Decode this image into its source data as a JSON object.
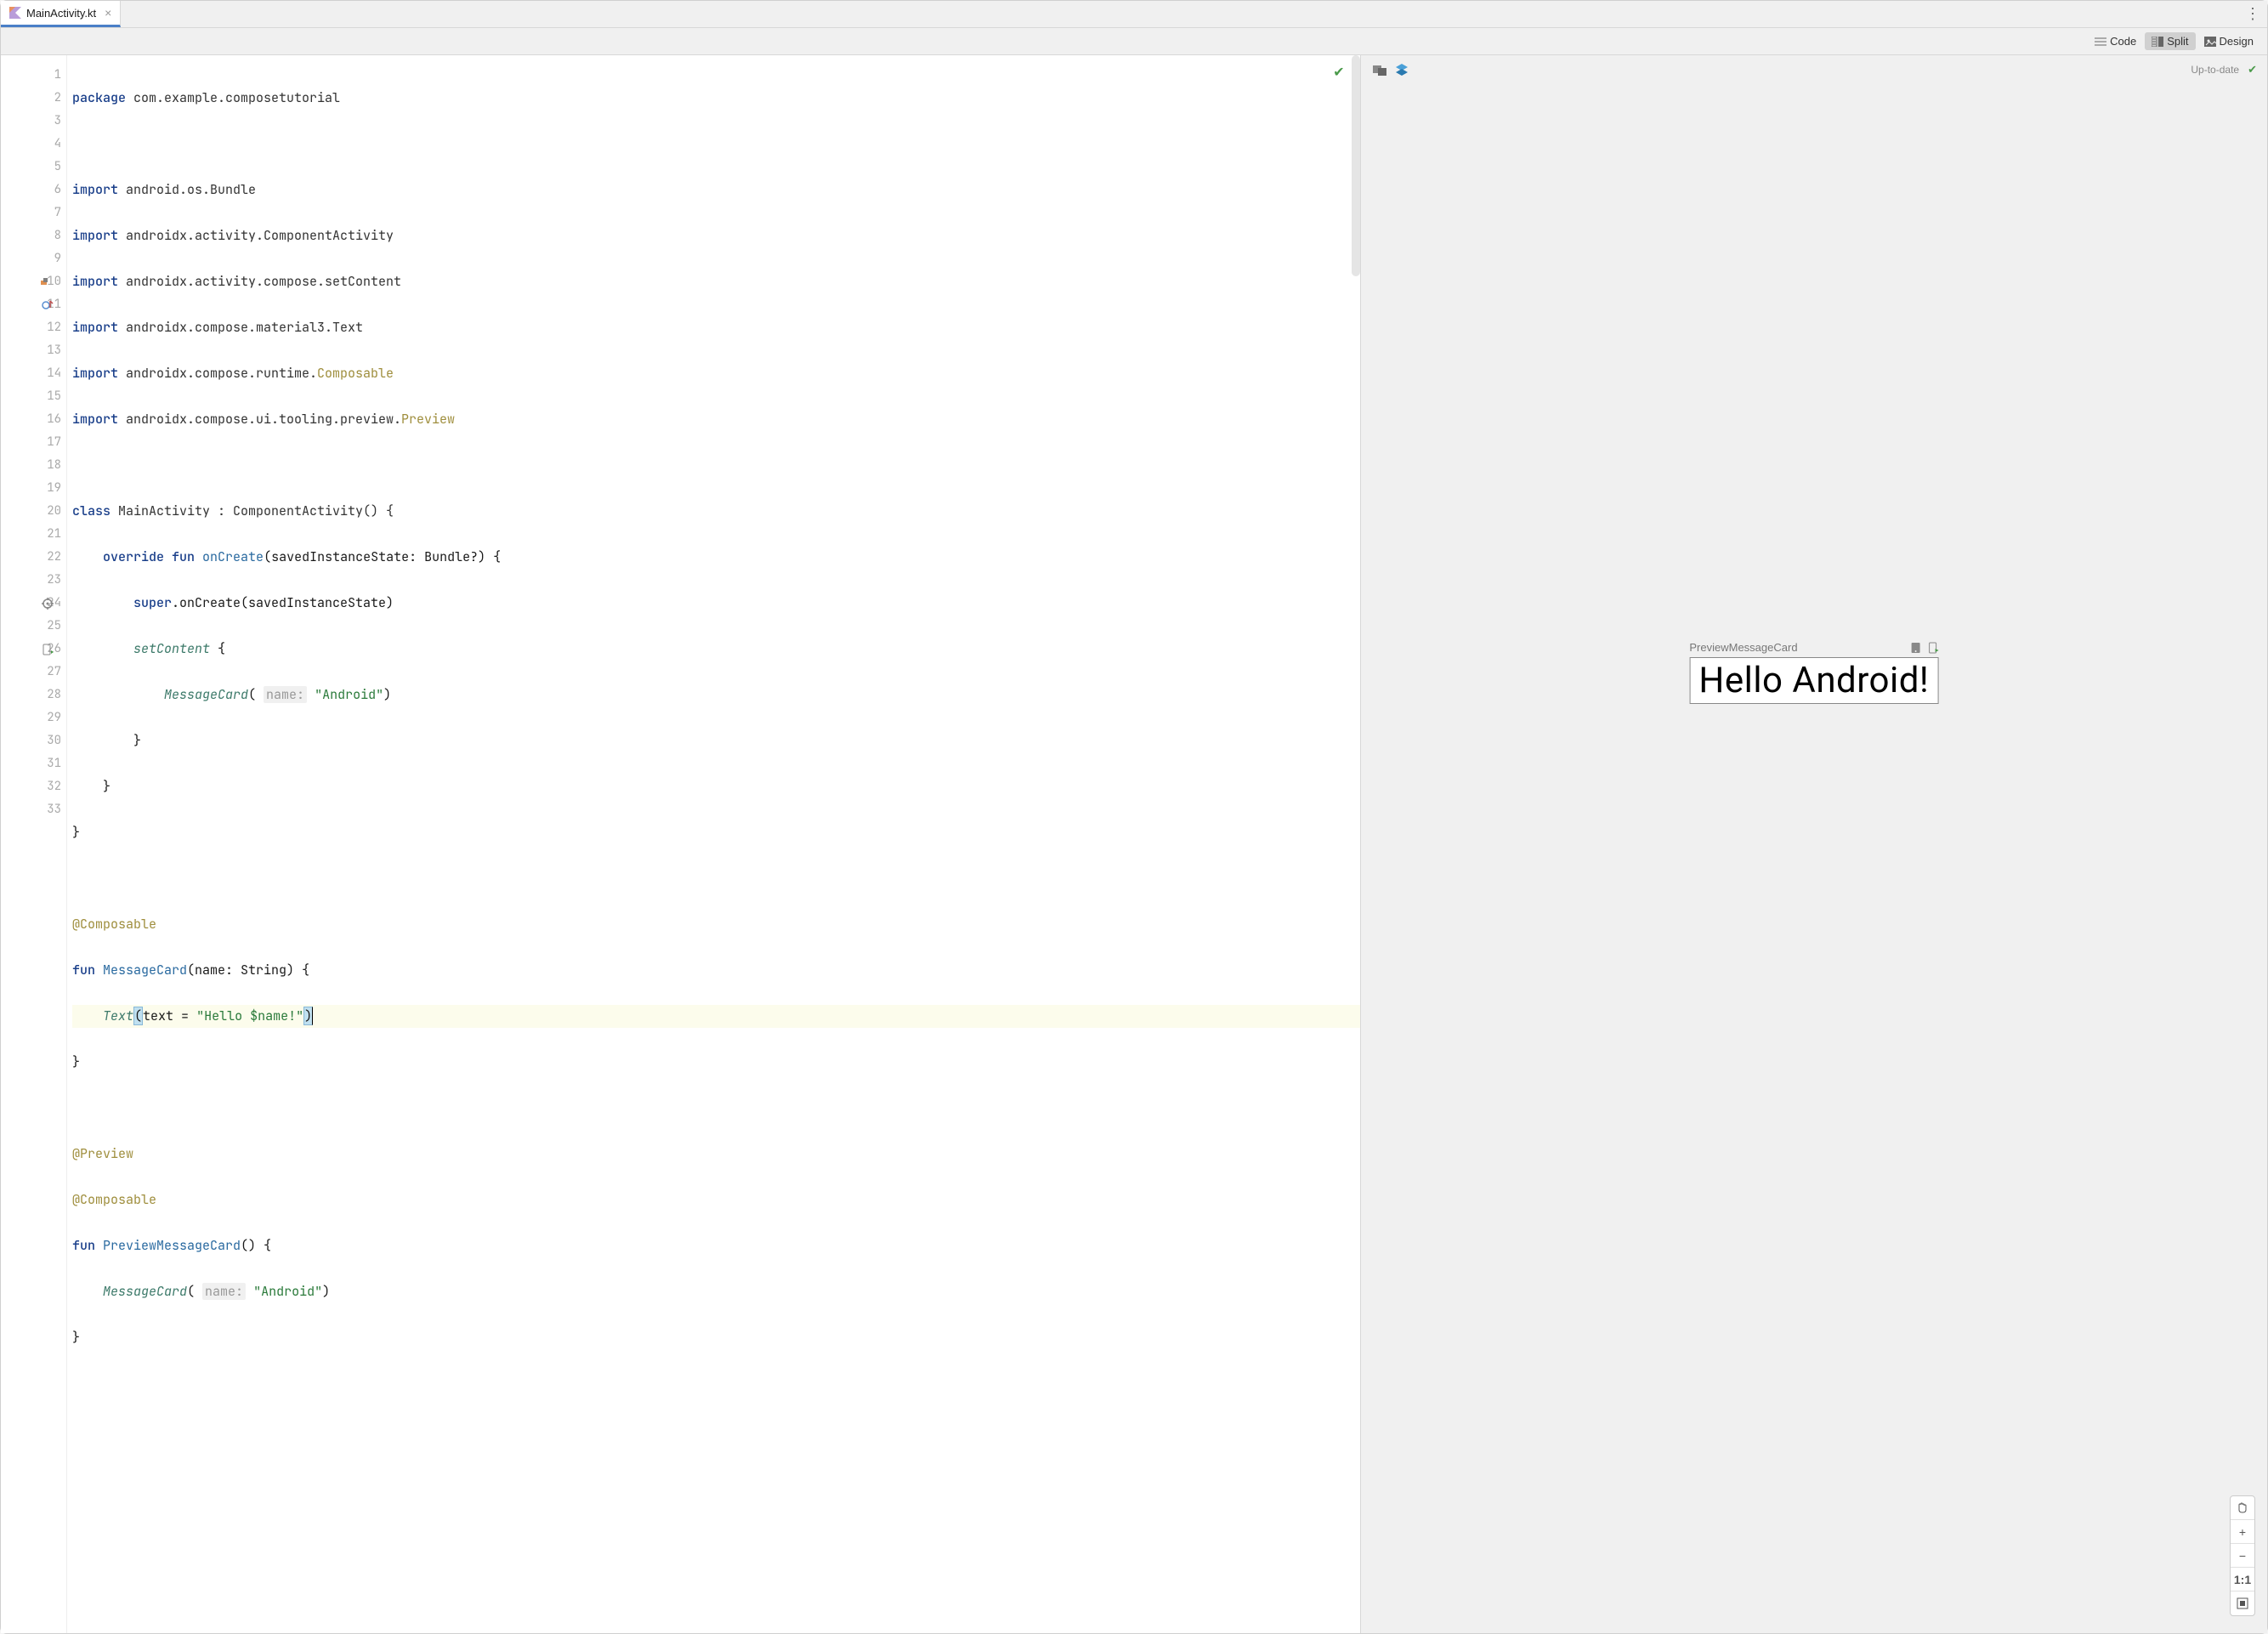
{
  "tab": {
    "filename": "MainActivity.kt"
  },
  "modes": {
    "code": "Code",
    "split": "Split",
    "design": "Design",
    "active": "split"
  },
  "editor": {
    "status": "ok",
    "line_count": 33,
    "current_line": 21
  },
  "code": {
    "l1_kw": "package",
    "l1_rest": " com.example.composetutorial",
    "l3_kw": "import",
    "l3_rest": " android.os.Bundle",
    "l4_kw": "import",
    "l4_rest": " androidx.activity.ComponentActivity",
    "l5_kw": "import",
    "l5_rest": " androidx.activity.compose.setContent",
    "l6_kw": "import",
    "l6_rest": " androidx.compose.material3.Text",
    "l7_kw": "import",
    "l7_rest": " androidx.compose.runtime.",
    "l7_ann": "Composable",
    "l8_kw": "import",
    "l8_rest": " androidx.compose.ui.tooling.preview.",
    "l8_ann": "Preview",
    "l10_kw1": "class",
    "l10_name": " MainActivity : ComponentActivity() {",
    "l11_kw1": "override",
    "l11_kw2": " fun",
    "l11_fn": " onCreate",
    "l11_rest": "(savedInstanceState: Bundle?) {",
    "l12_kw": "super",
    "l12_rest": ".onCreate(savedInstanceState)",
    "l13_fn": "setContent",
    "l13_rest": " {",
    "l14_fn": "MessageCard",
    "l14_hint": "name:",
    "l14_str": "\"Android\"",
    "l15": "}",
    "l16": "}",
    "l17": "}",
    "l19_ann": "@Composable",
    "l20_kw": "fun",
    "l20_fn": " MessageCard",
    "l20_rest": "(name: String) {",
    "l21_fn": "Text",
    "l21_param": "text = ",
    "l21_str": "\"Hello $name!\"",
    "l22": "}",
    "l24_ann": "@Preview",
    "l25_ann": "@Composable",
    "l26_kw": "fun",
    "l26_fn": " PreviewMessageCard",
    "l26_rest": "() {",
    "l27_fn": "MessageCard",
    "l27_hint": "name:",
    "l27_str": "\"Android\"",
    "l28": "}"
  },
  "preview": {
    "status": "Up-to-date",
    "composable_name": "PreviewMessageCard",
    "render_text": "Hello Android!"
  },
  "zoom": {
    "one_to_one": "1:1"
  }
}
